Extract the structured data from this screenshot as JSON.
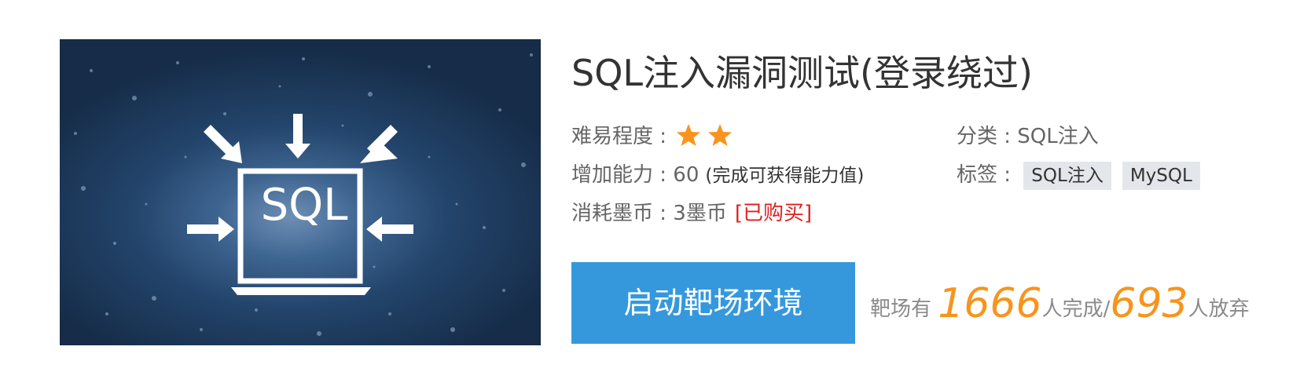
{
  "challenge": {
    "cover_icon_text": "SQL",
    "title": "SQL注入漏洞测试(登录绕过)",
    "difficulty_label": "难易程度 : ",
    "difficulty_stars": 2,
    "category_label": "分类 : ",
    "category_value": "SQL注入",
    "ability_label": "增加能力 : ",
    "ability_value": "60",
    "ability_note": "(完成可获得能力值)",
    "tags_label": "标签 : ",
    "tags": [
      "SQL注入",
      "MySQL"
    ],
    "cost_label": "消耗墨币 : ",
    "cost_value": "3墨币",
    "purchased_text": "[已购买]",
    "start_button_label": "启动靶场环境",
    "stats": {
      "prefix": "靶场有",
      "completed_count": "1666",
      "completed_suffix": "人完成/",
      "abandoned_count": "693",
      "abandoned_suffix": "人放弃"
    },
    "colors": {
      "accent_button": "#3598dc",
      "star": "#f7941d",
      "purchased": "#e02020",
      "count_highlight": "#f7941d"
    }
  }
}
